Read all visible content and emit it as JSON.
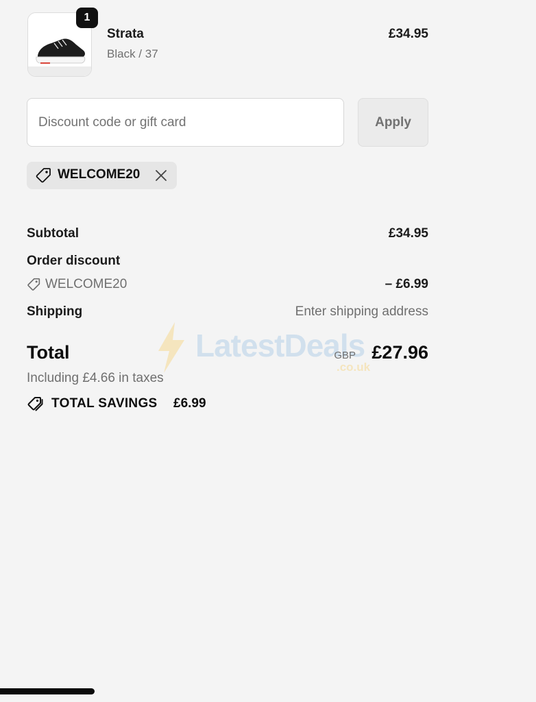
{
  "product": {
    "quantity": "1",
    "name": "Strata",
    "variant": "Black / 37",
    "price": "£34.95",
    "image_icon": "sneaker-image"
  },
  "discount": {
    "placeholder": "Discount code or gift card",
    "value": "",
    "apply_label": "Apply",
    "applied_code": "WELCOME20",
    "remove_icon": "close-icon"
  },
  "summary": {
    "subtotal_label": "Subtotal",
    "subtotal_value": "£34.95",
    "order_discount_label": "Order discount",
    "discount_code": "WELCOME20",
    "discount_value": "– £6.99",
    "shipping_label": "Shipping",
    "shipping_value": "Enter shipping address",
    "total_label": "Total",
    "currency": "GBP",
    "total_value": "£27.96",
    "taxes_note": "Including £4.66 in taxes",
    "savings_label": "TOTAL SAVINGS",
    "savings_value": "£6.99"
  },
  "watermark": {
    "brand": "LatestDeals",
    "domain": ".co.uk"
  },
  "colors": {
    "background": "#f4f4f4",
    "text": "#1b1b1b",
    "muted": "#6f6f6f",
    "chip": "#e6e6e6"
  }
}
